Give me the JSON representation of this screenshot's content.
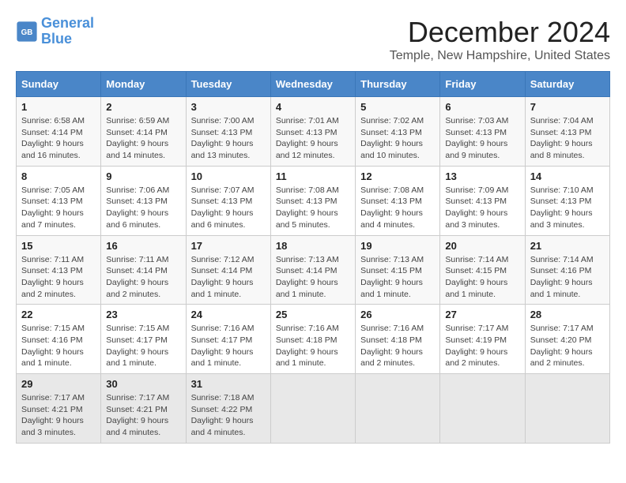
{
  "header": {
    "logo_line1": "General",
    "logo_line2": "Blue",
    "title": "December 2024",
    "subtitle": "Temple, New Hampshire, United States"
  },
  "weekdays": [
    "Sunday",
    "Monday",
    "Tuesday",
    "Wednesday",
    "Thursday",
    "Friday",
    "Saturday"
  ],
  "weeks": [
    [
      {
        "day": "1",
        "info": "Sunrise: 6:58 AM\nSunset: 4:14 PM\nDaylight: 9 hours and 16 minutes."
      },
      {
        "day": "2",
        "info": "Sunrise: 6:59 AM\nSunset: 4:14 PM\nDaylight: 9 hours and 14 minutes."
      },
      {
        "day": "3",
        "info": "Sunrise: 7:00 AM\nSunset: 4:13 PM\nDaylight: 9 hours and 13 minutes."
      },
      {
        "day": "4",
        "info": "Sunrise: 7:01 AM\nSunset: 4:13 PM\nDaylight: 9 hours and 12 minutes."
      },
      {
        "day": "5",
        "info": "Sunrise: 7:02 AM\nSunset: 4:13 PM\nDaylight: 9 hours and 10 minutes."
      },
      {
        "day": "6",
        "info": "Sunrise: 7:03 AM\nSunset: 4:13 PM\nDaylight: 9 hours and 9 minutes."
      },
      {
        "day": "7",
        "info": "Sunrise: 7:04 AM\nSunset: 4:13 PM\nDaylight: 9 hours and 8 minutes."
      }
    ],
    [
      {
        "day": "8",
        "info": "Sunrise: 7:05 AM\nSunset: 4:13 PM\nDaylight: 9 hours and 7 minutes."
      },
      {
        "day": "9",
        "info": "Sunrise: 7:06 AM\nSunset: 4:13 PM\nDaylight: 9 hours and 6 minutes."
      },
      {
        "day": "10",
        "info": "Sunrise: 7:07 AM\nSunset: 4:13 PM\nDaylight: 9 hours and 6 minutes."
      },
      {
        "day": "11",
        "info": "Sunrise: 7:08 AM\nSunset: 4:13 PM\nDaylight: 9 hours and 5 minutes."
      },
      {
        "day": "12",
        "info": "Sunrise: 7:08 AM\nSunset: 4:13 PM\nDaylight: 9 hours and 4 minutes."
      },
      {
        "day": "13",
        "info": "Sunrise: 7:09 AM\nSunset: 4:13 PM\nDaylight: 9 hours and 3 minutes."
      },
      {
        "day": "14",
        "info": "Sunrise: 7:10 AM\nSunset: 4:13 PM\nDaylight: 9 hours and 3 minutes."
      }
    ],
    [
      {
        "day": "15",
        "info": "Sunrise: 7:11 AM\nSunset: 4:13 PM\nDaylight: 9 hours and 2 minutes."
      },
      {
        "day": "16",
        "info": "Sunrise: 7:11 AM\nSunset: 4:14 PM\nDaylight: 9 hours and 2 minutes."
      },
      {
        "day": "17",
        "info": "Sunrise: 7:12 AM\nSunset: 4:14 PM\nDaylight: 9 hours and 1 minute."
      },
      {
        "day": "18",
        "info": "Sunrise: 7:13 AM\nSunset: 4:14 PM\nDaylight: 9 hours and 1 minute."
      },
      {
        "day": "19",
        "info": "Sunrise: 7:13 AM\nSunset: 4:15 PM\nDaylight: 9 hours and 1 minute."
      },
      {
        "day": "20",
        "info": "Sunrise: 7:14 AM\nSunset: 4:15 PM\nDaylight: 9 hours and 1 minute."
      },
      {
        "day": "21",
        "info": "Sunrise: 7:14 AM\nSunset: 4:16 PM\nDaylight: 9 hours and 1 minute."
      }
    ],
    [
      {
        "day": "22",
        "info": "Sunrise: 7:15 AM\nSunset: 4:16 PM\nDaylight: 9 hours and 1 minute."
      },
      {
        "day": "23",
        "info": "Sunrise: 7:15 AM\nSunset: 4:17 PM\nDaylight: 9 hours and 1 minute."
      },
      {
        "day": "24",
        "info": "Sunrise: 7:16 AM\nSunset: 4:17 PM\nDaylight: 9 hours and 1 minute."
      },
      {
        "day": "25",
        "info": "Sunrise: 7:16 AM\nSunset: 4:18 PM\nDaylight: 9 hours and 1 minute."
      },
      {
        "day": "26",
        "info": "Sunrise: 7:16 AM\nSunset: 4:18 PM\nDaylight: 9 hours and 2 minutes."
      },
      {
        "day": "27",
        "info": "Sunrise: 7:17 AM\nSunset: 4:19 PM\nDaylight: 9 hours and 2 minutes."
      },
      {
        "day": "28",
        "info": "Sunrise: 7:17 AM\nSunset: 4:20 PM\nDaylight: 9 hours and 2 minutes."
      }
    ],
    [
      {
        "day": "29",
        "info": "Sunrise: 7:17 AM\nSunset: 4:21 PM\nDaylight: 9 hours and 3 minutes."
      },
      {
        "day": "30",
        "info": "Sunrise: 7:17 AM\nSunset: 4:21 PM\nDaylight: 9 hours and 4 minutes."
      },
      {
        "day": "31",
        "info": "Sunrise: 7:18 AM\nSunset: 4:22 PM\nDaylight: 9 hours and 4 minutes."
      },
      null,
      null,
      null,
      null
    ]
  ]
}
